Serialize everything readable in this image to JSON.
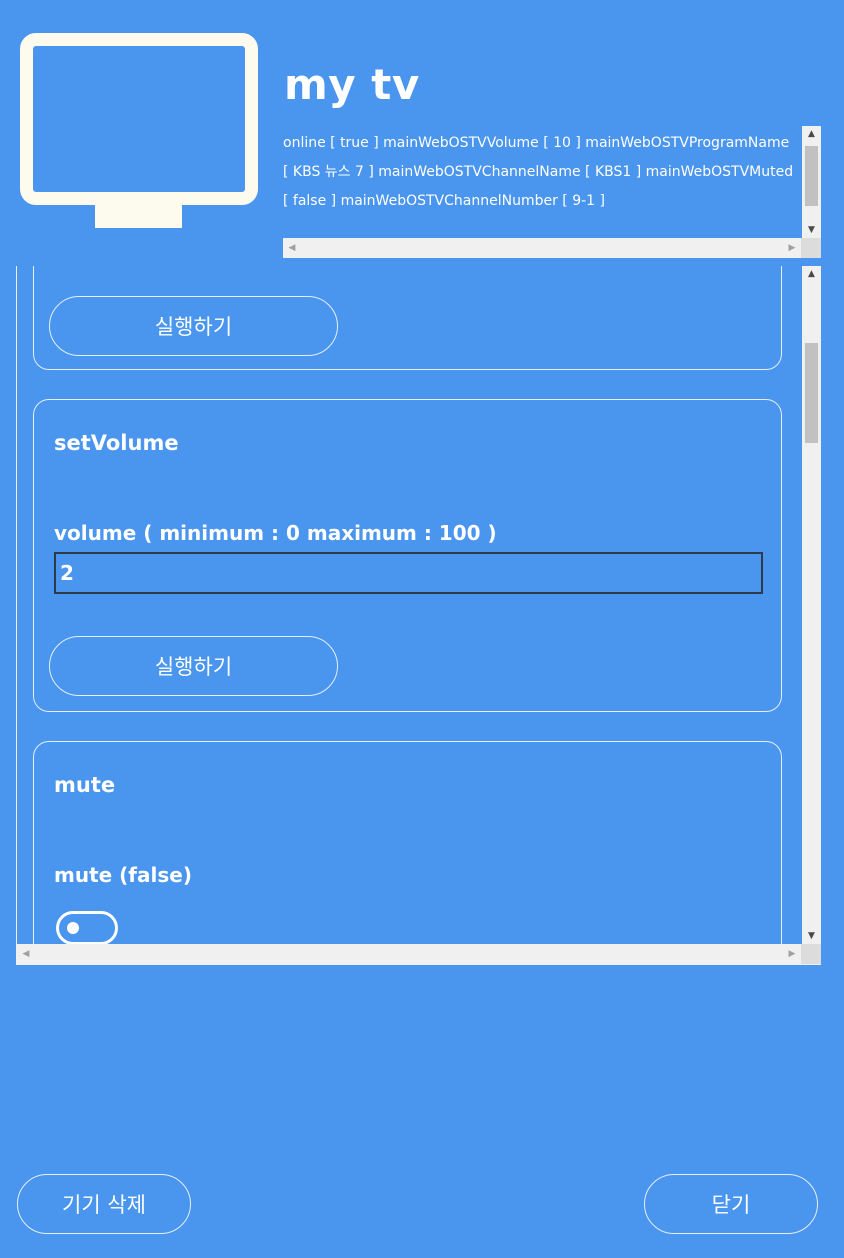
{
  "device": {
    "name": "my tv",
    "icon": "tv-icon",
    "status_text": "online [ true ] mainWebOSTVVolume [ 10 ] mainWebOSTVProgramName [ KBS 뉴스 7 ] mainWebOSTVChannelName [ KBS1 ] mainWebOSTVMuted [ false ] mainWebOSTVChannelNumber [ 9-1 ]"
  },
  "functions": {
    "prev_card": {
      "run_label": "실행하기"
    },
    "set_volume": {
      "title": "setVolume",
      "param_label": "volume ( minimum : 0 maximum : 100 )",
      "value": "2",
      "run_label": "실행하기"
    },
    "mute": {
      "title": "mute",
      "param_label": "mute (false)",
      "toggle_on": false
    }
  },
  "footer": {
    "delete_label": "기기 삭제",
    "close_label": "닫기"
  },
  "colors": {
    "background": "#4a95ee",
    "tv_icon": "#fcfbee",
    "scrollbar": "#f0f0f0",
    "thumb": "#c1c1c1"
  }
}
